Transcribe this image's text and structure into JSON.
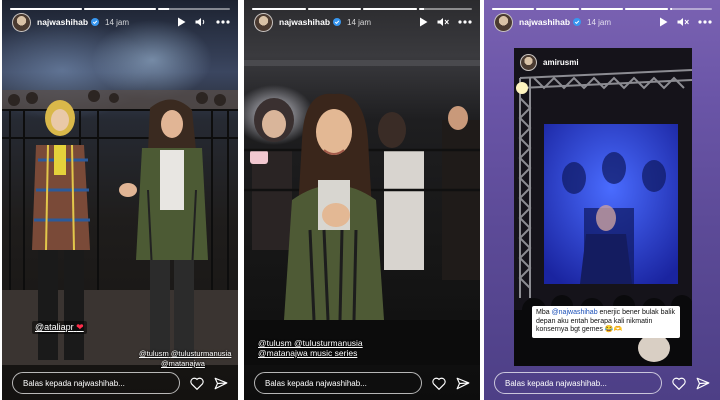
{
  "colors": {
    "heart": "#ff2d4a",
    "mention": "#1a4fb8",
    "verified": "#3897f0"
  },
  "icons": {
    "play": "play-icon",
    "mute": "mute-icon",
    "more": "more-icon",
    "like": "heart-icon",
    "share": "send-icon"
  },
  "stories": [
    {
      "username": "najwashihab",
      "time": "14 jam",
      "progress": [
        1.0,
        1.0,
        0.15
      ],
      "reply_placeholder": "Balas kepada najwashihab...",
      "tag_sticker": "@ataliapr",
      "tag_emoji": "❤",
      "mentions": [
        "@tulusm",
        "@tulusturmanusia",
        "@matanajwa"
      ]
    },
    {
      "username": "najwashihab",
      "time": "14 jam",
      "progress": [
        1.0,
        1.0,
        1.0,
        0.1
      ],
      "reply_placeholder": "Balas kepada najwashihab...",
      "caption_lines": [
        "@tulusm @tulusturmanusia",
        "@matanajwa music series"
      ]
    },
    {
      "username": "najwashihab",
      "time": "14 jam",
      "progress": [
        1.0,
        1.0,
        1.0,
        1.0,
        0.05
      ],
      "reply_placeholder": "Balas kepada najwashihab...",
      "reshared_username": "amirusmi",
      "comment": {
        "prefix": "Mba ",
        "mention": "@najwashihab",
        "text": " enerjic bener bulak balik depan aku entah berapa kali nikmatin konsernya bgt gemes 😂🫶"
      }
    }
  ]
}
